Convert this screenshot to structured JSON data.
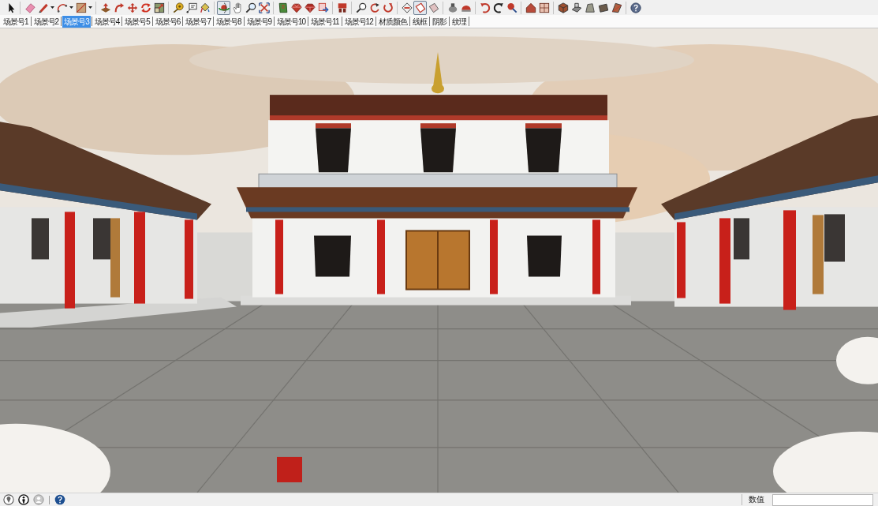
{
  "toolbar": {
    "groups": [
      [
        {
          "selected": false,
          "dropdown": false
        }
      ],
      [
        {
          "selected": false,
          "dropdown": false
        },
        {
          "selected": false,
          "dropdown": true
        },
        {
          "selected": false,
          "dropdown": true
        },
        {
          "selected": false,
          "dropdown": true
        }
      ],
      [
        {
          "selected": false,
          "dropdown": false
        },
        {
          "selected": false,
          "dropdown": false
        },
        {
          "selected": false,
          "dropdown": false
        },
        {
          "selected": false,
          "dropdown": false
        },
        {
          "selected": false,
          "dropdown": false
        }
      ],
      [
        {
          "selected": false,
          "dropdown": false
        },
        {
          "selected": false,
          "dropdown": false
        },
        {
          "selected": false,
          "dropdown": false
        }
      ],
      [
        {
          "selected": true,
          "dropdown": false
        },
        {
          "selected": false,
          "dropdown": false
        },
        {
          "selected": false,
          "dropdown": false
        },
        {
          "selected": false,
          "dropdown": false
        }
      ],
      [
        {
          "selected": false,
          "dropdown": false
        },
        {
          "selected": false,
          "dropdown": false
        },
        {
          "selected": false,
          "dropdown": false
        },
        {
          "selected": false,
          "dropdown": false
        }
      ],
      [
        {
          "selected": false,
          "dropdown": false
        }
      ],
      [
        {
          "selected": false,
          "dropdown": false
        },
        {
          "selected": false,
          "dropdown": false
        },
        {
          "selected": false,
          "dropdown": false
        }
      ],
      [
        {
          "selected": false,
          "dropdown": false
        },
        {
          "selected": true,
          "dropdown": false
        },
        {
          "selected": false,
          "dropdown": false
        }
      ],
      [
        {
          "selected": false,
          "dropdown": false
        },
        {
          "selected": false,
          "dropdown": false
        }
      ],
      [
        {
          "selected": false,
          "dropdown": false
        },
        {
          "selected": false,
          "dropdown": false
        },
        {
          "selected": false,
          "dropdown": false
        }
      ],
      [
        {
          "selected": false,
          "dropdown": false
        },
        {
          "selected": false,
          "dropdown": false
        }
      ],
      [
        {
          "selected": false,
          "dropdown": false
        },
        {
          "selected": false,
          "dropdown": false
        },
        {
          "selected": false,
          "dropdown": false
        },
        {
          "selected": false,
          "dropdown": false
        },
        {
          "selected": false,
          "dropdown": false
        }
      ],
      [
        {
          "selected": false,
          "dropdown": false
        }
      ]
    ]
  },
  "scene_tabs": [
    {
      "label": "场景号1",
      "selected": false
    },
    {
      "label": "场景号2",
      "selected": false
    },
    {
      "label": "场景号3",
      "selected": true
    },
    {
      "label": "场景号4",
      "selected": false
    },
    {
      "label": "场景号5",
      "selected": false
    },
    {
      "label": "场景号6",
      "selected": false
    },
    {
      "label": "场景号7",
      "selected": false
    },
    {
      "label": "场景号8",
      "selected": false
    },
    {
      "label": "场景号9",
      "selected": false
    },
    {
      "label": "场景号10",
      "selected": false
    },
    {
      "label": "场景号11",
      "selected": false
    },
    {
      "label": "场景号12",
      "selected": false
    },
    {
      "label": "材质颜色",
      "selected": false
    },
    {
      "label": "线框",
      "selected": false
    },
    {
      "label": "阴影",
      "selected": false
    },
    {
      "label": "纹理",
      "selected": false
    }
  ],
  "status_bar": {
    "measurements": {
      "label": "数值"
    }
  }
}
